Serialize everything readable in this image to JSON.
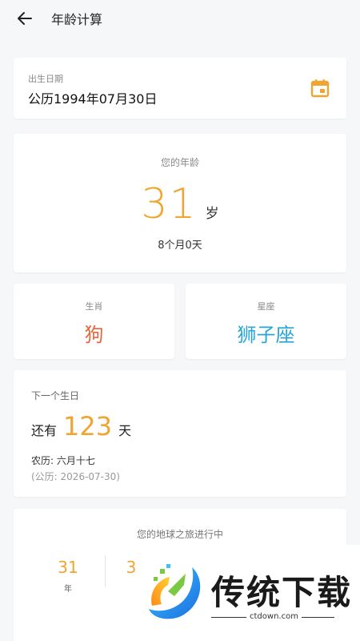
{
  "header": {
    "title": "年龄计算"
  },
  "birth": {
    "label": "出生日期",
    "value": "公历1994年07月30日"
  },
  "age": {
    "label": "您的年龄",
    "years": "31",
    "unit": "岁",
    "detail": "8个月0天"
  },
  "zodiac": {
    "label": "生肖",
    "value": "狗"
  },
  "star_sign": {
    "label": "星座",
    "value": "狮子座"
  },
  "next_birthday": {
    "label": "下一个生日",
    "prefix": "还有",
    "days": "123",
    "unit": "天",
    "lunar": "农历: 六月十七",
    "solar": "(公历: 2026-07-30)"
  },
  "journey": {
    "title": "您的地球之旅进行中",
    "stats": [
      {
        "value": "31",
        "unit": "年"
      },
      {
        "value": "3",
        "unit": ""
      }
    ]
  },
  "watermark": {
    "text": "传统下载",
    "url": "ctdown.com"
  },
  "colors": {
    "accent_orange": "#f0a531",
    "zodiac_red": "#e5663b",
    "sign_blue": "#28a6d8",
    "background": "#f6f7f9"
  },
  "icons": {
    "back": "arrow-left-icon",
    "calendar": "calendar-icon"
  }
}
